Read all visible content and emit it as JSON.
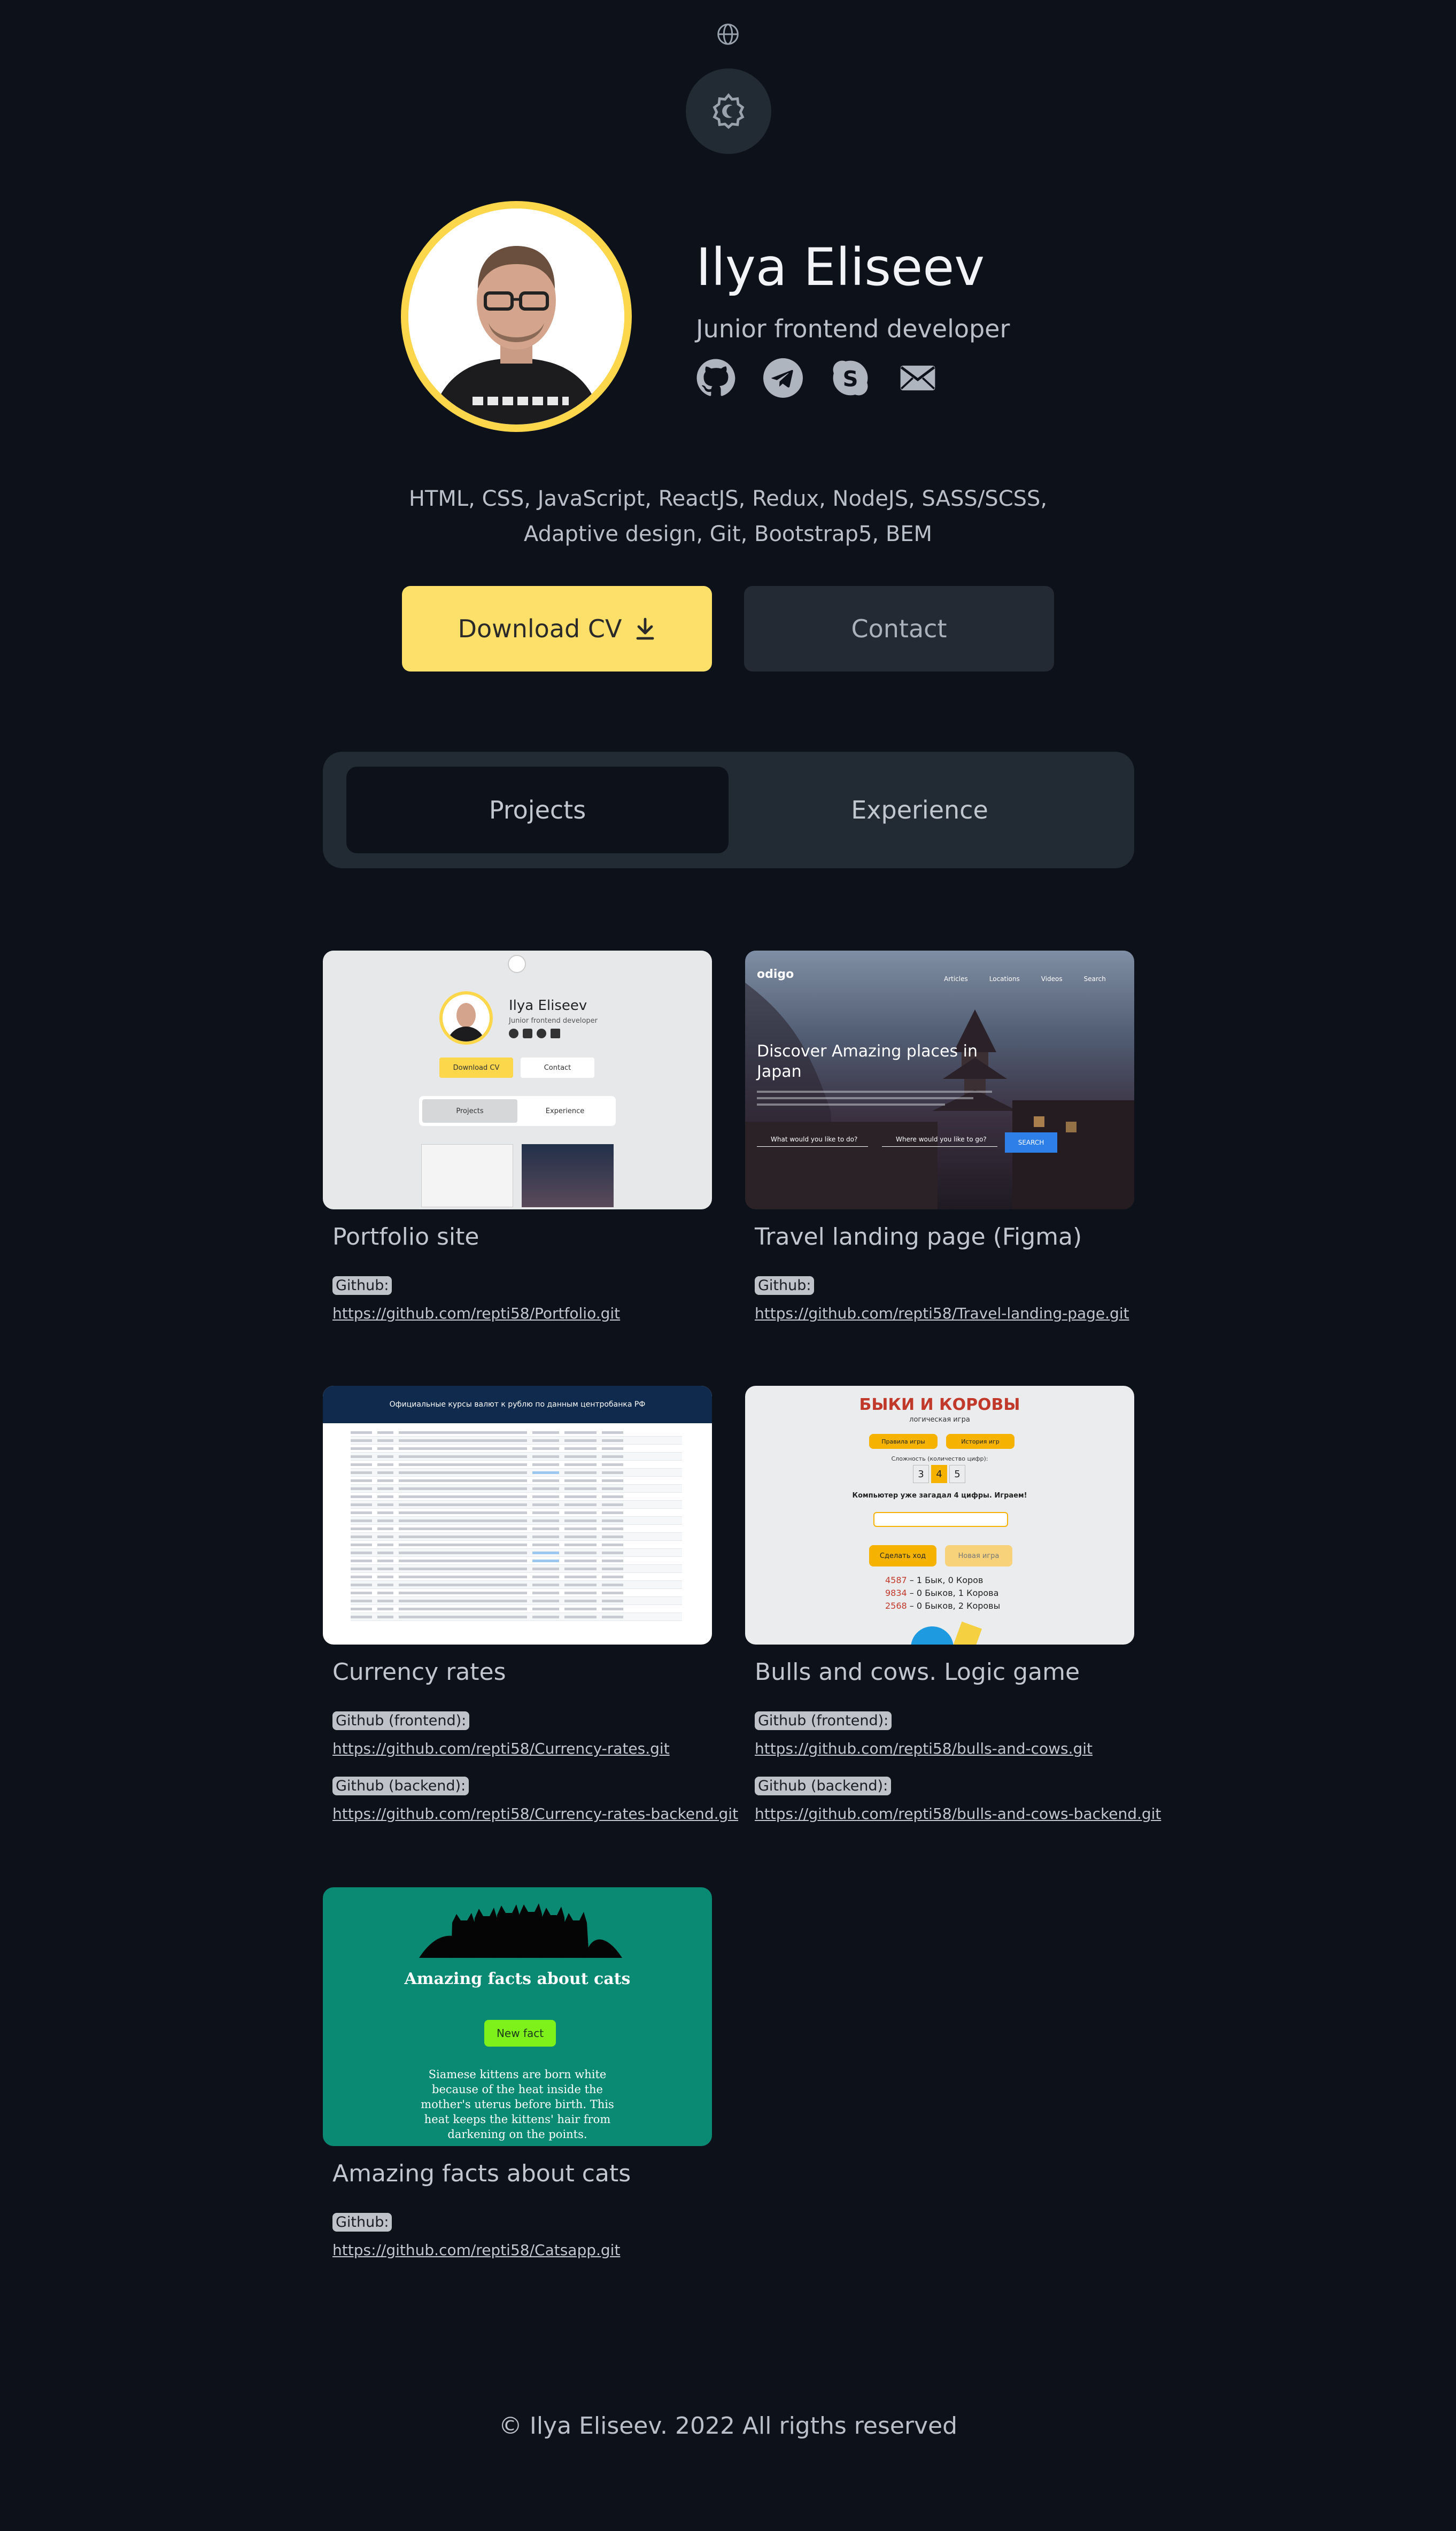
{
  "header": {
    "language_icon": "globe-icon",
    "theme_icon": "sun-icon"
  },
  "profile": {
    "name": "Ilya Eliseev",
    "role": "Junior frontend developer",
    "socials": [
      {
        "icon": "github-icon"
      },
      {
        "icon": "telegram-icon"
      },
      {
        "icon": "skype-icon"
      },
      {
        "icon": "mail-icon"
      }
    ],
    "skills": "HTML, CSS, JavaScript, ReactJS, Redux, NodeJS, SASS/SCSS, Adaptive design, Git, Bootstrap5, BEM",
    "download_cv": "Download CV",
    "contact": "Contact"
  },
  "tabs": [
    {
      "label": "Projects",
      "active": true
    },
    {
      "label": "Experience",
      "active": false
    }
  ],
  "projects": [
    {
      "title": "Portfolio site",
      "links": [
        {
          "label": "Github:",
          "url": "https://github.com/repti58/Portfolio.git"
        }
      ],
      "thumb": {
        "name": "Ilya Eliseev",
        "role": "Junior frontend developer",
        "cv": "Download CV",
        "contact": "Contact",
        "tab1": "Projects",
        "tab2": "Experience"
      }
    },
    {
      "title": "Travel landing page (Figma)",
      "links": [
        {
          "label": "Github:",
          "url": "https://github.com/repti58/Travel-landing-page.git"
        }
      ],
      "thumb": {
        "logo": "odigo",
        "nav": [
          "Articles",
          "Locations",
          "Videos",
          "Search"
        ],
        "headline": "Discover Amazing places in Japan",
        "field1": "What would you like to do?",
        "field2": "Where would you like to go?",
        "search": "SEARCH"
      }
    },
    {
      "title": "Currency rates",
      "links": [
        {
          "label": "Github (frontend):",
          "url": "https://github.com/repti58/Currency-rates.git"
        },
        {
          "label": "Github (backend):",
          "url": "https://github.com/repti58/Currency-rates-backend.git"
        }
      ],
      "thumb": {
        "header": "Официальные курсы валют к рублю по данным центробанка РФ"
      }
    },
    {
      "title": "Bulls and cows. Logic game",
      "links": [
        {
          "label": "Github (frontend):",
          "url": "https://github.com/repti58/bulls-and-cows.git"
        },
        {
          "label": "Github (backend):",
          "url": "https://github.com/repti58/bulls-and-cows-backend.git"
        }
      ],
      "thumb": {
        "title": "БЫКИ И КОРОВЫ",
        "subtitle": "логическая игра",
        "rules": "Правила игры",
        "history": "История игр",
        "difficulty": "Сложность (количество цифр):",
        "digits": [
          "3",
          "4",
          "5"
        ],
        "prompt": "Компьютер уже загадал 4 цифры. Играем!",
        "move": "Сделать ход",
        "new_game": "Новая игра",
        "guesses": [
          {
            "num": "4587",
            "res": " – 1 Бык, 0 Коров"
          },
          {
            "num": "9834",
            "res": " – 0 Быков, 1 Корова"
          },
          {
            "num": "2568",
            "res": " – 0 Быков, 2 Коровы"
          }
        ]
      }
    },
    {
      "title": "Amazing facts about cats",
      "links": [
        {
          "label": "Github:",
          "url": "https://github.com/repti58/Catsapp.git"
        }
      ],
      "thumb": {
        "heading": "Amazing facts about cats",
        "button": "New fact",
        "fact": "Siamese kittens are born white because of the heat inside the mother's uterus before birth. This heat keeps the kittens' hair from darkening on the points."
      }
    }
  ],
  "footer": "© Ilya Eliseev. 2022 All rigths reserved",
  "colors": {
    "background": "#0c111a",
    "accent": "#fde06a",
    "surface": "#222a33"
  }
}
